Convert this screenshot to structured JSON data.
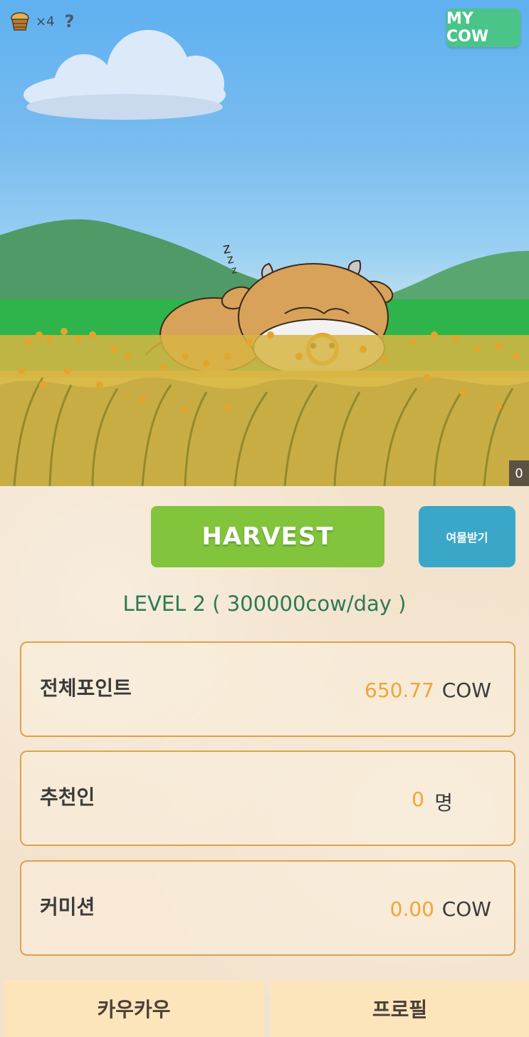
{
  "hud": {
    "basket_icon": "basket-icon",
    "basket_count": "×4",
    "help_icon_glyph": "?"
  },
  "header": {
    "mycow_label": "MY COW"
  },
  "scene": {
    "sleep_text": "zzz",
    "corner_badge": "0"
  },
  "actions": {
    "harvest_label": "HARVEST",
    "gift_label": "여물받기"
  },
  "level": {
    "text": "LEVEL 2 ( 300000cow/day )"
  },
  "stats": {
    "total_points": {
      "label": "전체포인트",
      "value": "650.77",
      "unit": "COW"
    },
    "referrals": {
      "label": "추천인",
      "value": "0",
      "unit": "명"
    },
    "commission": {
      "label": "커미션",
      "value": "0.00",
      "unit": "COW"
    }
  },
  "nav": {
    "tab_home": "카우카우",
    "tab_profile": "프로필"
  },
  "colors": {
    "harvest_green": "#82c43c",
    "gift_blue": "#3aa7c9",
    "mycow_green": "#4bc48a",
    "level_text": "#2c7a54",
    "value_orange": "#f0a536",
    "card_border": "#e0a04c",
    "nav_bg": "#fde5bb"
  }
}
